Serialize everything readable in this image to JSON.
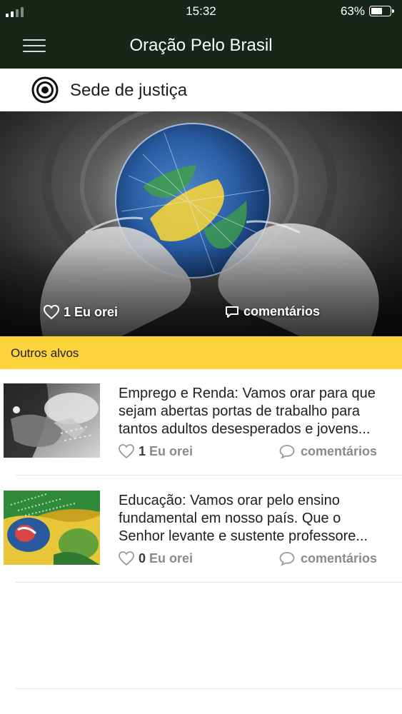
{
  "status_bar": {
    "time": "15:32",
    "battery_percent": "63%",
    "battery_level": 0.63
  },
  "header": {
    "title": "Oração Pelo Brasil",
    "menu_icon": "hamburger-menu-icon"
  },
  "featured": {
    "icon": "target-icon",
    "title": "Sede de justiça",
    "like_count": "1",
    "like_label": "Eu orei",
    "comments_label": "comentários"
  },
  "section": {
    "title": "Outros alvos"
  },
  "items": [
    {
      "text_lines": [
        "Emprego e Renda: Vamos orar para que",
        "sejam abertas portas de trabalho para",
        "tantos adultos desesperados e jovens..."
      ],
      "like_count": "1",
      "like_label": "Eu orei",
      "comments_label": "comentários"
    },
    {
      "text_lines": [
        "Educação: Vamos orar pelo ensino",
        "fundamental em nosso país. Que o",
        "Senhor levante e sustente professore..."
      ],
      "like_count": "0",
      "like_label": "Eu orei",
      "comments_label": "comentários"
    }
  ],
  "colors": {
    "header_bg": "#172619",
    "section_bar": "#fcd33a",
    "meta_gray": "#8a8a8a"
  }
}
